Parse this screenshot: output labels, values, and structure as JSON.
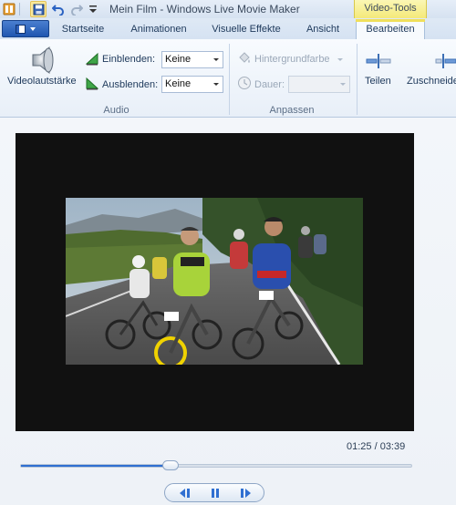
{
  "window": {
    "title": "Mein Film - Windows Live Movie Maker",
    "context_tab_group": "Video-Tools"
  },
  "quick_access": {
    "icons": [
      "app-icon",
      "save-icon",
      "undo-icon",
      "redo-icon",
      "customize-icon"
    ]
  },
  "tabs": {
    "items": [
      "Startseite",
      "Animationen",
      "Visuelle Effekte",
      "Ansicht",
      "Bearbeiten"
    ],
    "active": "Bearbeiten"
  },
  "ribbon": {
    "audio": {
      "group_label": "Audio",
      "volume_label": "Videolautstärke",
      "fade_in_label": "Einblenden:",
      "fade_in_value": "Keine",
      "fade_out_label": "Ausblenden:",
      "fade_out_value": "Keine"
    },
    "adjust": {
      "group_label": "Anpassen",
      "background_color_label": "Hintergrundfarbe",
      "duration_label": "Dauer:",
      "duration_value": ""
    },
    "edit": {
      "split_label": "Teilen",
      "trim_label": "Zuschneide"
    }
  },
  "player": {
    "time": "01:25 / 03:39",
    "progress": 0.39
  },
  "colors": {
    "accent": "#2f6fd1",
    "context_tab": "#f4e97a",
    "app_button": "#1f56b0"
  }
}
